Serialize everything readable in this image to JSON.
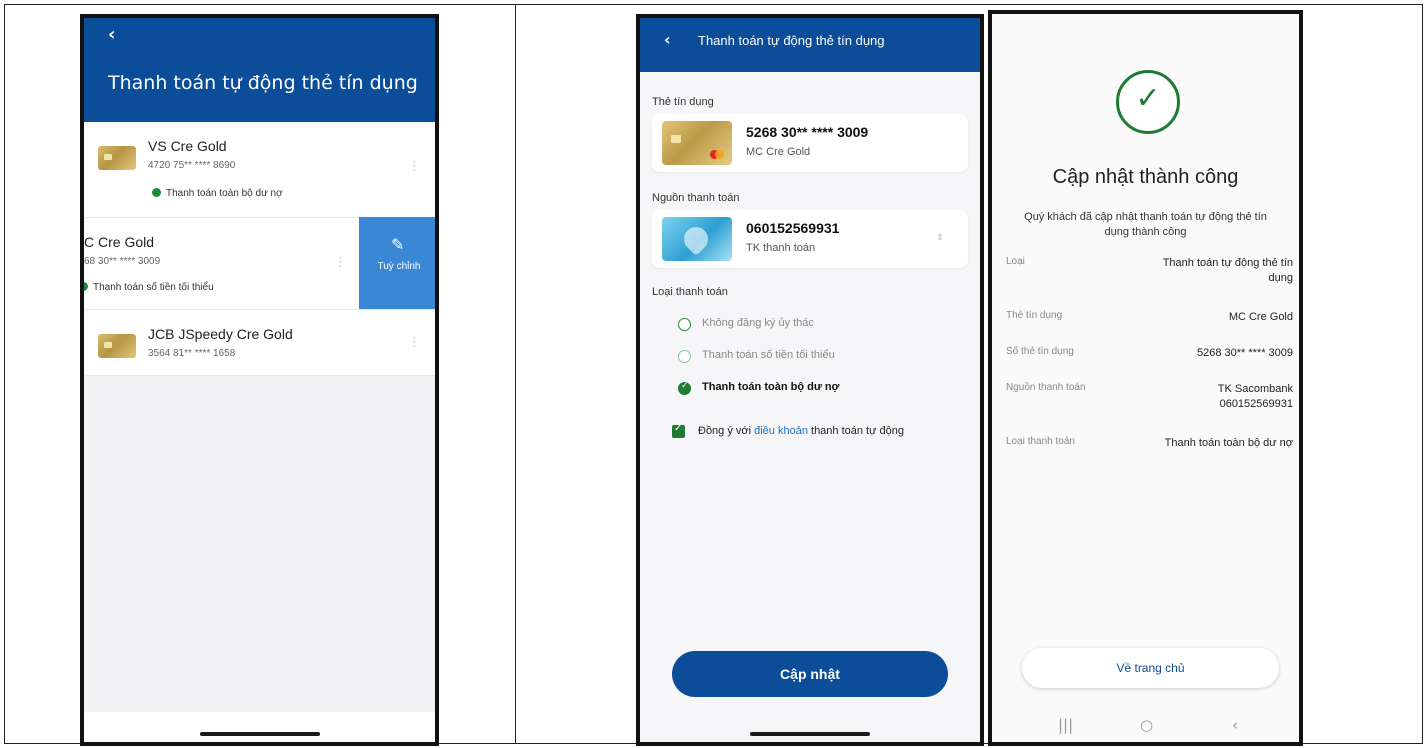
{
  "screen1": {
    "back_icon": "chevron-left-icon",
    "title": "Thanh toán tự động thẻ tín dụng",
    "cards": [
      {
        "name": "VS Cre Gold",
        "number": "4720 75** **** 8690",
        "status": "Thanh toán toàn bộ dư nợ"
      },
      {
        "name": "C Cre Gold",
        "number": "68 30** **** 3009",
        "status": "Thanh toán số tiền tối thiểu"
      },
      {
        "name": "JCB JSpeedy Cre Gold",
        "number": "3564 81** **** 1658"
      }
    ],
    "swipe_action": {
      "label": "Tuỳ chỉnh",
      "icon": "pencil-icon"
    },
    "colors": {
      "header": "#0b4d98",
      "action": "#3a87d6",
      "status_dot": "#1c8a3c"
    }
  },
  "screen2": {
    "back_icon": "chevron-left-icon",
    "title": "Thanh toán tự động thẻ tín dụng",
    "credit_card_label": "Thẻ tín dụng",
    "credit_card": {
      "number": "5268 30** **** 3009",
      "name": "MC Cre Gold"
    },
    "payment_source_label": "Nguồn thanh toán",
    "payment_source": {
      "account": "060152569931",
      "type": "TK thanh toán"
    },
    "payment_type_label": "Loại thanh toán",
    "payment_options": [
      {
        "label": "Không đăng ký ủy thác",
        "selected": false
      },
      {
        "label": "Thanh toán số tiền tối thiểu",
        "selected": false
      },
      {
        "label": "Thanh toán toàn bộ dư nợ",
        "selected": true
      }
    ],
    "agree": {
      "prefix": "Đồng ý với ",
      "link": "điều khoản",
      "suffix": " thanh toán tự động",
      "checked": true
    },
    "submit_label": "Cập nhật"
  },
  "screen3": {
    "success_icon": "check-circle-icon",
    "title": "Cập nhật thành công",
    "description": "Quý khách đã cập nhật thanh toán tự động thẻ tín dụng thành công",
    "details": [
      {
        "label": "Loại",
        "value": "Thanh toán tự động thẻ tín dụng"
      },
      {
        "label": "Thẻ tín dụng",
        "value": "MC Cre Gold"
      },
      {
        "label": "Số thẻ tín dụng",
        "value": "5268 30** **** 3009"
      },
      {
        "label": "Nguồn thanh toán",
        "value": "TK Sacombank 060152569931"
      },
      {
        "label": "Loại thanh toán",
        "value": "Thanh toán toàn bộ dư nợ"
      }
    ],
    "home_label": "Về trang chủ",
    "nav": {
      "recents_icon": "recents-icon",
      "home_icon": "home-circle-icon",
      "back_icon": "back-arrow-icon"
    },
    "colors": {
      "success": "#1f7a33",
      "link": "#1f6fc4"
    }
  }
}
